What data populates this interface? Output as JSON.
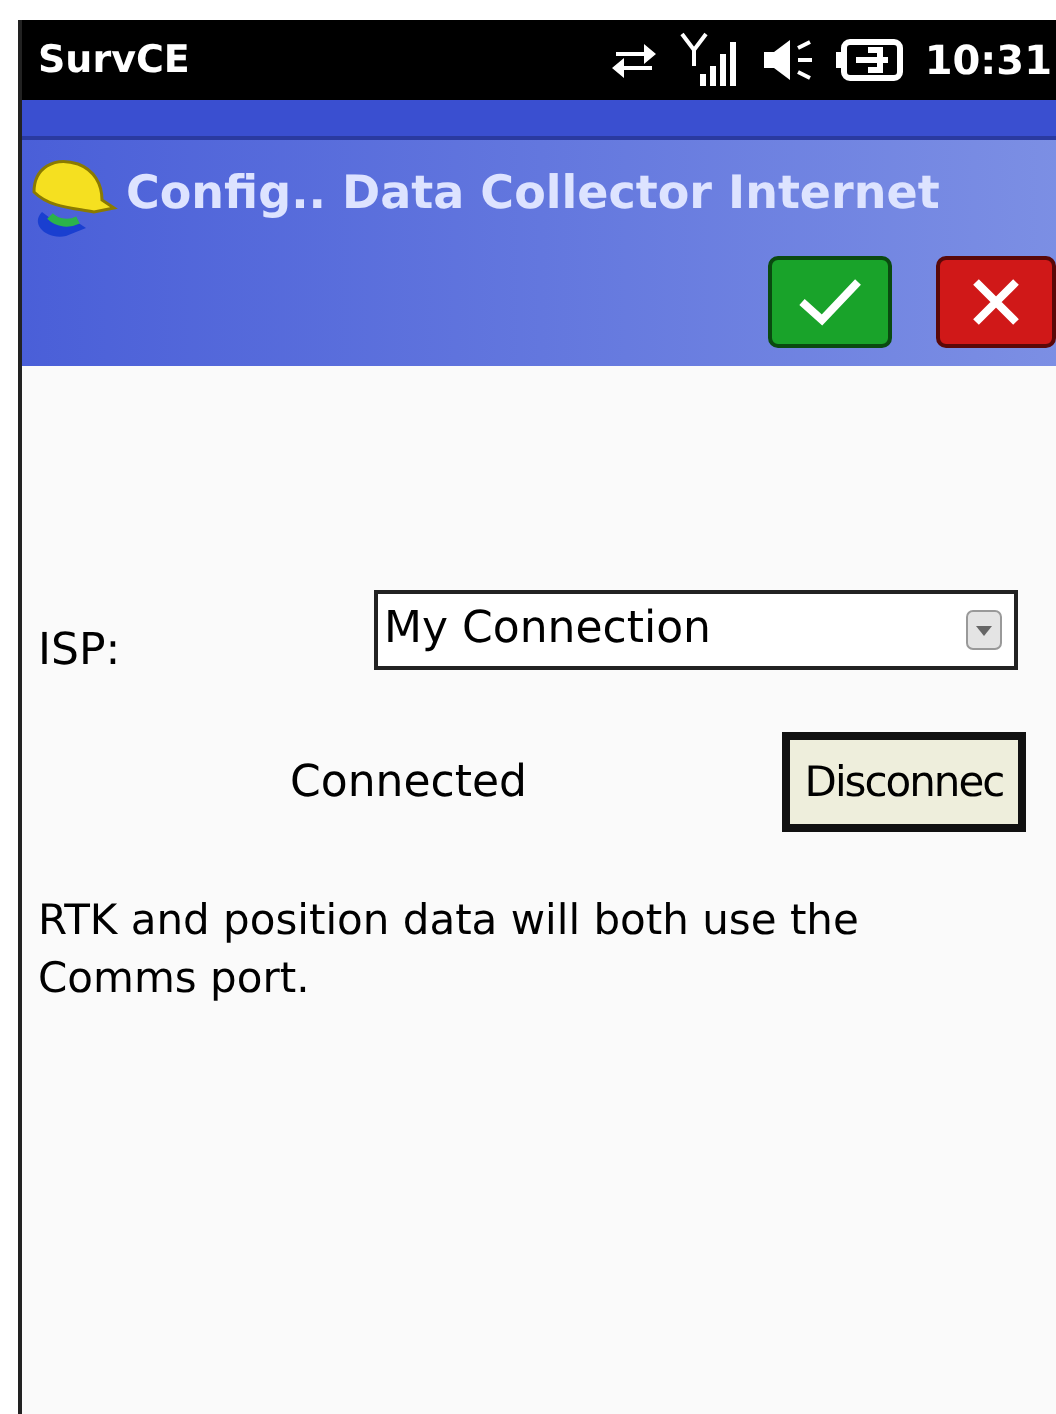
{
  "status_bar": {
    "app": "SurvCE",
    "time": "10:31"
  },
  "title_bar": {
    "title": "Config.. Data Collector Internet"
  },
  "form": {
    "isp_label": "ISP:",
    "isp_value": "My Connection",
    "status": "Connected",
    "button": "Disconnec"
  },
  "message": "RTK and position data will both use the Comms port."
}
